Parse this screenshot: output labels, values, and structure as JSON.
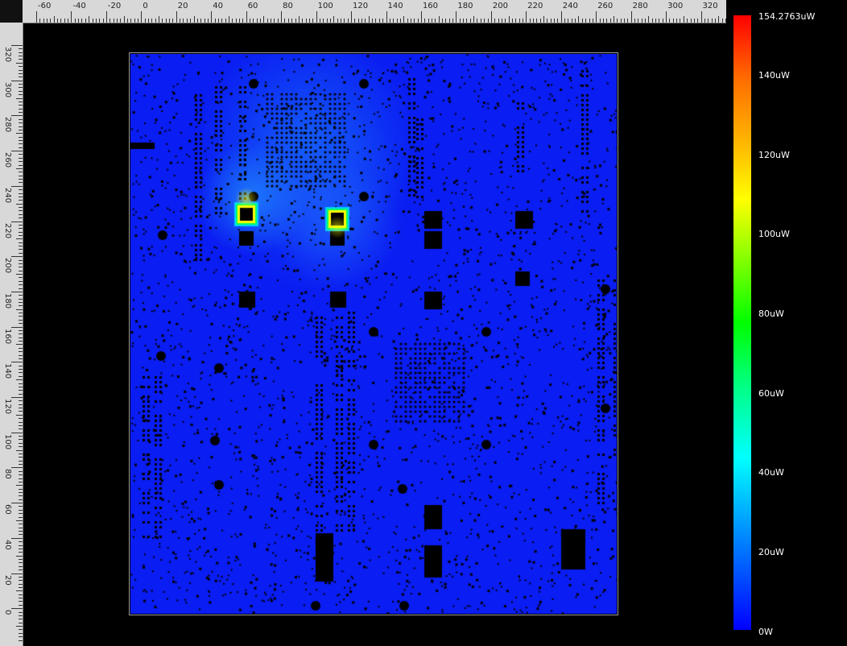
{
  "ruler_top": {
    "labels": [
      "-60",
      "-40",
      "-20",
      "0",
      "20",
      "40",
      "60",
      "80",
      "100",
      "120",
      "140",
      "160",
      "180",
      "200",
      "220",
      "240",
      "260",
      "280",
      "300",
      "320"
    ]
  },
  "ruler_left": {
    "labels": [
      "320",
      "300",
      "280",
      "260",
      "240",
      "220",
      "200",
      "180",
      "160",
      "140",
      "120",
      "100",
      "80",
      "60",
      "40",
      "20",
      "0"
    ]
  },
  "legend": {
    "max_label": "154.2763uW",
    "labels": [
      "140uW",
      "120uW",
      "100uW",
      "80uW",
      "60uW",
      "40uW",
      "20uW"
    ],
    "min_label": "0W"
  },
  "colors": {
    "board_base": "#0a1df2",
    "hotspot_high": "#ffff00",
    "hotspot_mid": "#00ff66",
    "hotspot_low": "#00ccff"
  }
}
